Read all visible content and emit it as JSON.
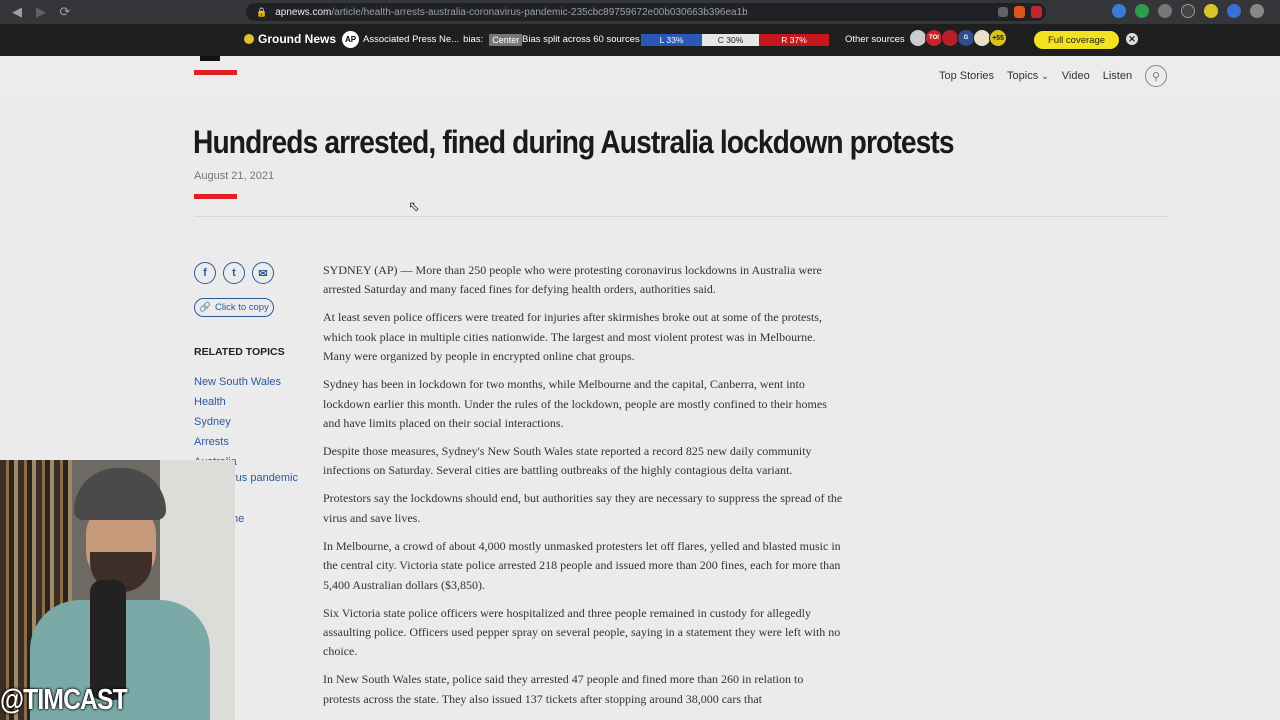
{
  "browser": {
    "url_host": "apnews.com",
    "url_path": "/article/health-arrests-australia-coronavirus-pandemic-235cbc89759672e00b030663b396ea1b"
  },
  "ground_news": {
    "brand": "Ground News",
    "source": "Associated Press Ne...",
    "bias_label": "bias:",
    "bias_value": "Center",
    "bias_split": "Bias split across 60 sources",
    "left": "L 33%",
    "center": "C 30%",
    "right": "R 37%",
    "other_sources": "Other sources",
    "more_count": "+55",
    "full_coverage": "Full coverage"
  },
  "site_nav": {
    "items": [
      "Top Stories",
      "Topics",
      "Video",
      "Listen"
    ]
  },
  "article": {
    "headline": "Hundreds arrested, fined during Australia lockdown protests",
    "date": "August 21, 2021",
    "copy_label": "Click to copy",
    "related_heading": "RELATED TOPICS",
    "related": [
      "New South Wales",
      "Health",
      "Sydney",
      "Arrests",
      "Australia"
    ],
    "related_partial": [
      "rus pandemic",
      "ne"
    ],
    "paragraphs": [
      "SYDNEY (AP) — More than 250 people who were protesting coronavirus lockdowns in Australia were arrested Saturday and many faced fines for defying health orders, authorities said.",
      "At least seven police officers were treated for injuries after skirmishes broke out at some of the protests, which took place in multiple cities nationwide. The largest and most violent protest was in Melbourne. Many were organized by people in encrypted online chat groups.",
      "Sydney has been in lockdown for two months, while Melbourne and the capital, Canberra, went into lockdown earlier this month. Under the rules of the lockdown, people are mostly confined to their homes and have limits placed on their social interactions.",
      "Despite those measures, Sydney's New South Wales state reported a record 825 new daily community infections on Saturday. Several cities are battling outbreaks of the highly contagious delta variant.",
      "Protestors say the lockdowns should end, but authorities say they are necessary to suppress the spread of the virus and save lives.",
      "In Melbourne, a crowd of about 4,000 mostly unmasked protesters let off flares, yelled and blasted music in the central city. Victoria state police arrested 218 people and issued more than 200 fines, each for more than 5,400 Australian dollars ($3,850).",
      "Six Victoria state police officers were hospitalized and three people remained in custody for allegedly assaulting police. Officers used pepper spray on several people, saying in a statement they were left with no choice.",
      "In New South Wales state, police said they arrested 47 people and fined more than 260 in relation to protests across the state. They also issued 137 tickets after stopping around 38,000 cars that"
    ]
  },
  "overlay": {
    "handle": "@TIMCAST"
  },
  "colors": {
    "accent_red": "#e11f26",
    "link_blue": "#2b5a9b",
    "ground_news_yellow": "#f2e21f"
  }
}
